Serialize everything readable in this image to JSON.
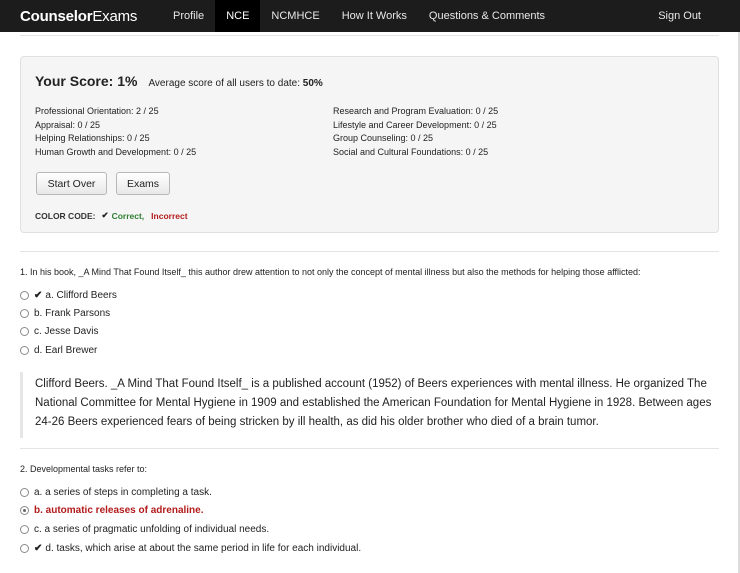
{
  "nav": {
    "brand_bold": "Counselor",
    "brand_rest": "Exams",
    "items": [
      "Profile",
      "NCE",
      "NCMHCE",
      "How It Works",
      "Questions & Comments"
    ],
    "signout": "Sign Out"
  },
  "score": {
    "title": "Your Score: 1%",
    "avg_label": "Average score of all users to date:",
    "avg_value": "50%",
    "categories_left": [
      "Professional Orientation: 2 / 25",
      "Appraisal: 0 / 25",
      "Helping Relationships: 0 / 25",
      "Human Growth and Development: 0 / 25"
    ],
    "categories_right": [
      "Research and Program Evaluation: 0 / 25",
      "Lifestyle and Career Development: 0 / 25",
      "Group Counseling: 0 / 25",
      "Social and Cultural Foundations: 0 / 25"
    ],
    "start_over": "Start Over",
    "exams": "Exams",
    "color_code_label": "COLOR CODE:",
    "correct_label": "Correct,",
    "incorrect_label": "Incorrect",
    "correct_color": "#2e7d32",
    "incorrect_color": "#b31b1b"
  },
  "questions": [
    {
      "text": "1. In his book, _A Mind That Found Itself_ this author drew attention to not only the concept of mental illness but also the methods for helping those afflicted:",
      "options": [
        "a. Clifford Beers",
        "b. Frank Parsons",
        "c. Jesse Davis",
        "d. Earl Brewer"
      ],
      "explanation": "Clifford Beers. _A Mind That Found Itself_ is a published account (1952) of Beers experiences with mental illness. He organized The National Committee for Mental Hygiene in 1909 and established the American Foundation for Mental Hygiene in 1928. Between ages 24-26 Beers experienced fears of being stricken by ill health, as did his older brother who died of a brain tumor."
    },
    {
      "text": "2. Developmental tasks refer to:",
      "options": [
        "a. a series of steps in completing a task.",
        "b. automatic releases of adrenaline.",
        "c. a series of pragmatic unfolding of individual needs.",
        "d. tasks, which arise at about the same period in life for each individual."
      ]
    }
  ]
}
